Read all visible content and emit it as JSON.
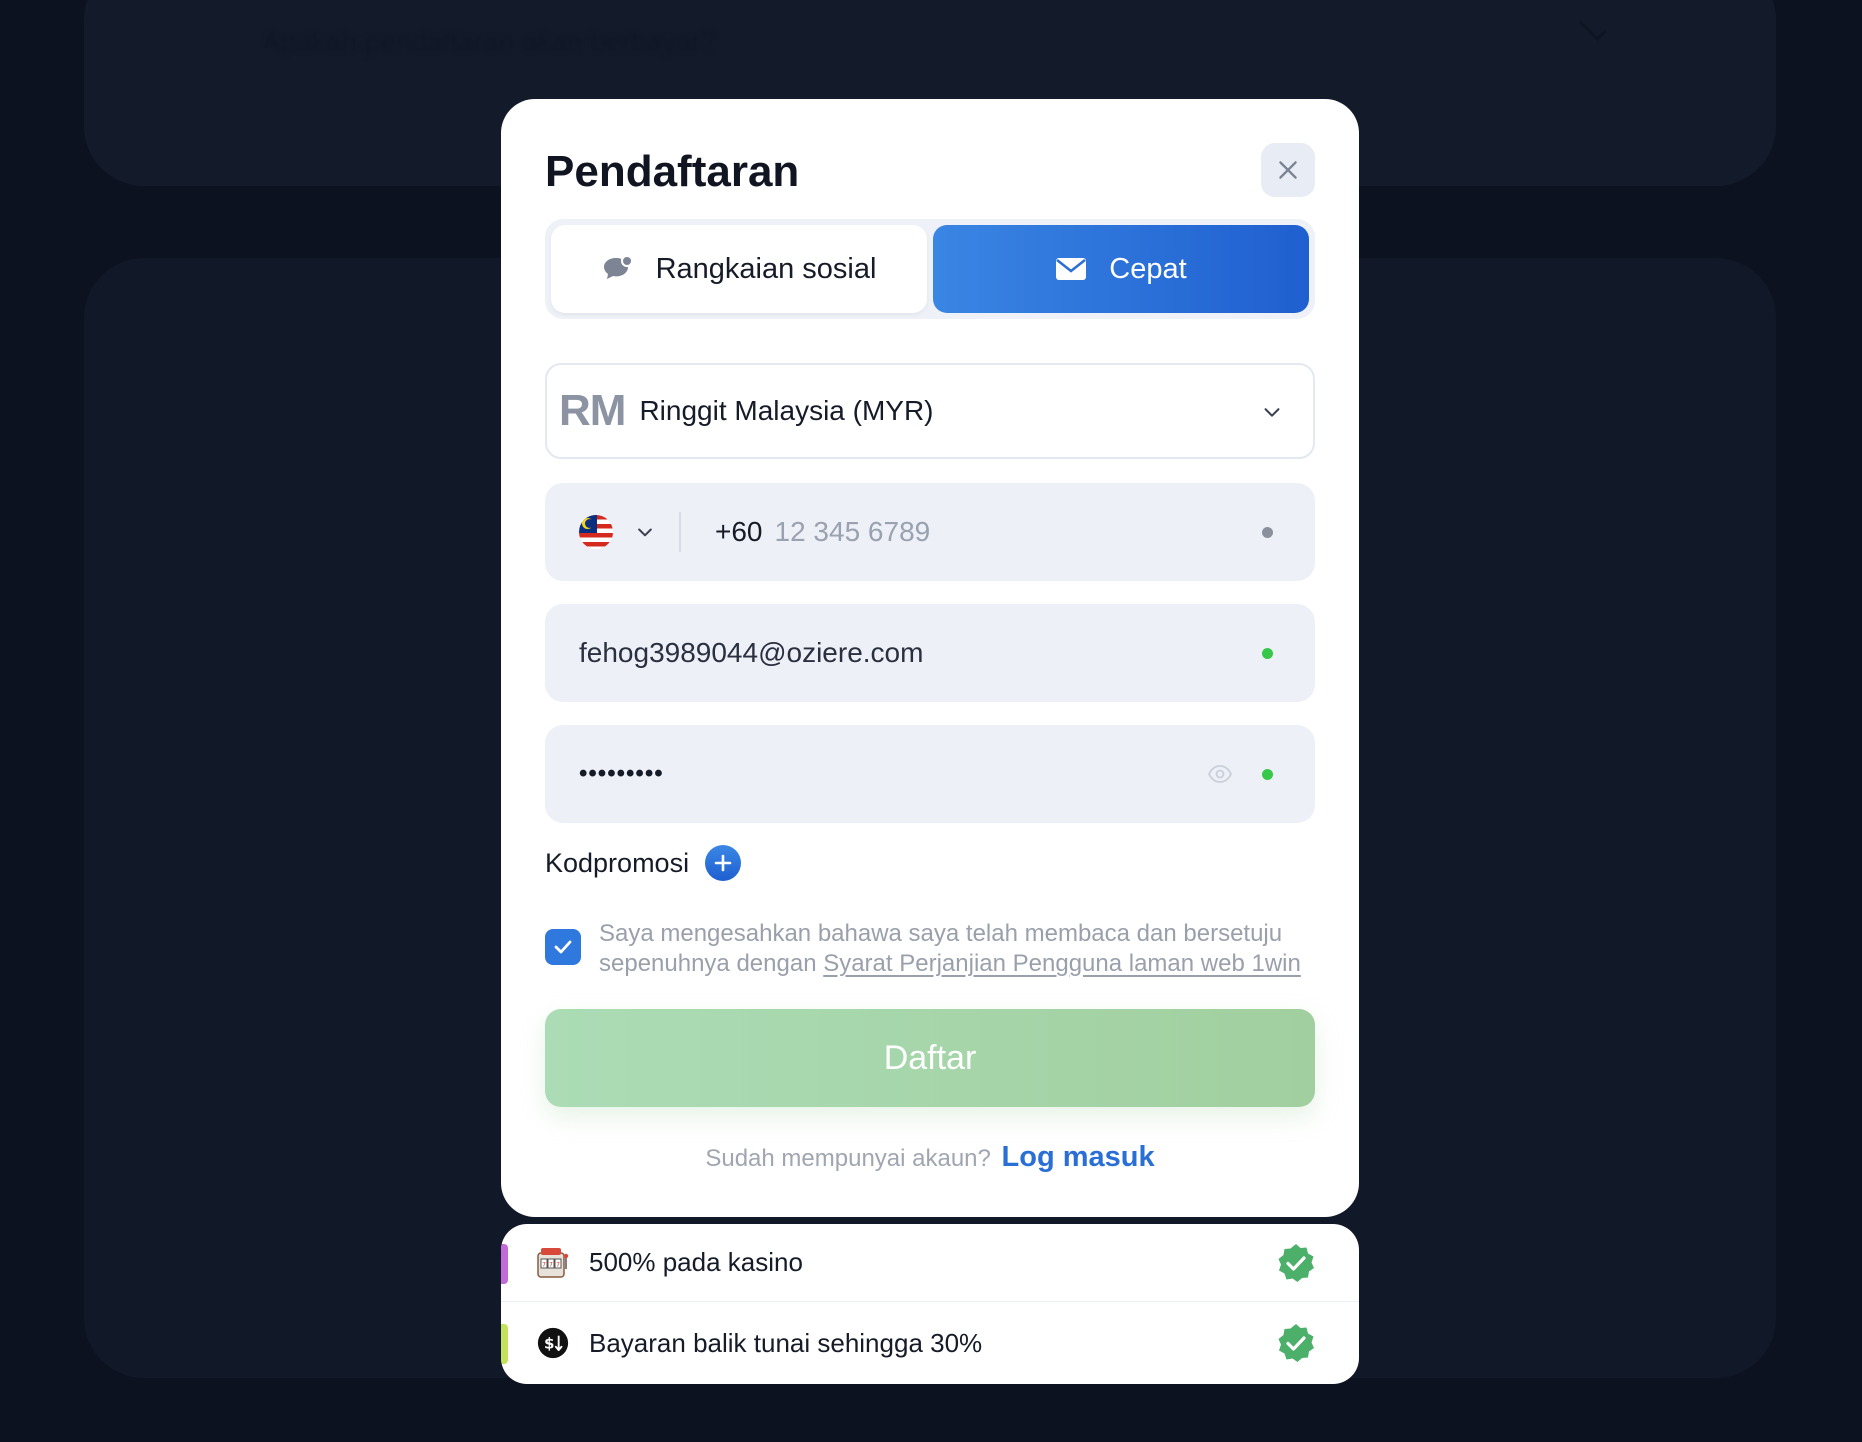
{
  "background": {
    "faq_text": "Apakah pendaftaran akan berbayar?"
  },
  "modal": {
    "title": "Pendaftaran",
    "close_icon": "close-icon",
    "tabs": [
      {
        "label": "Rangkaian sosial",
        "icon": "chat-bubbles-icon",
        "active": false
      },
      {
        "label": "Cepat",
        "icon": "envelope-icon",
        "active": true
      }
    ],
    "currency": {
      "symbol": "RM",
      "label": "Ringgit Malaysia (MYR)"
    },
    "phone": {
      "country_flag": "malaysia-flag-icon",
      "code": "+60",
      "placeholder": "12 345 6789"
    },
    "email": {
      "value": "fehog3989044@oziere.com"
    },
    "password": {
      "value": "•••••••••"
    },
    "promo": {
      "label": "Kodpromosi"
    },
    "consent": {
      "text": "Saya mengesahkan bahawa saya telah membaca dan bersetuju sepenuhnya dengan ",
      "link": "Syarat Perjanjian Pengguna laman web 1win",
      "checked": true
    },
    "submit_label": "Daftar",
    "login": {
      "prompt": "Sudah mempunyai akaun?",
      "link": "Log masuk"
    }
  },
  "bonuses": [
    {
      "label": "500% pada kasino",
      "icon": "slot-machine-icon",
      "accent": "#c26ad6"
    },
    {
      "label": "Bayaran balik tunai sehingga 30%",
      "icon": "cashback-icon",
      "accent": "#c4e35a"
    }
  ],
  "colors": {
    "primary": "#2a6fd6",
    "success": "#37c84a",
    "submit_disabled": "#a9d8b2",
    "overlay": "#0c121f"
  }
}
